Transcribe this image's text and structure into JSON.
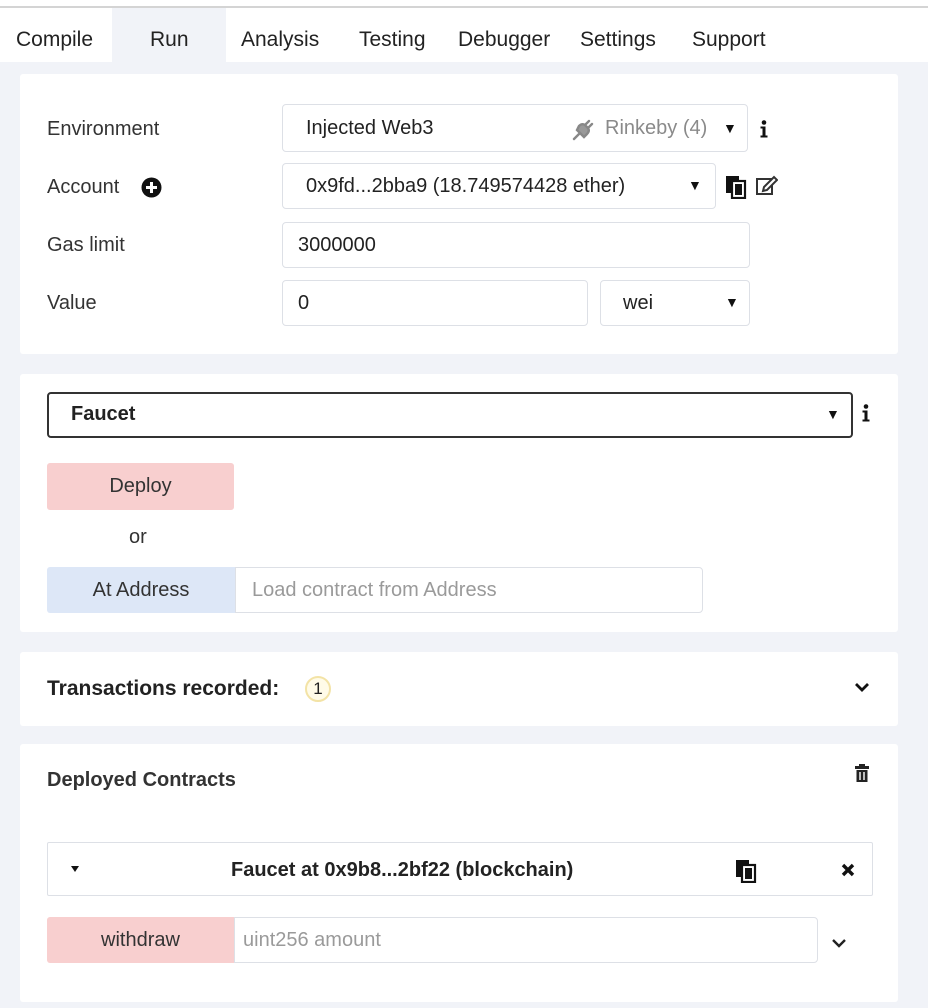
{
  "tabs": [
    "Compile",
    "Run",
    "Analysis",
    "Testing",
    "Debugger",
    "Settings",
    "Support"
  ],
  "active_tab": "Run",
  "env_section": {
    "environment_label": "Environment",
    "environment_value": "Injected Web3",
    "network": "Rinkeby (4)",
    "account_label": "Account",
    "account_value": "0x9fd...2bba9 (18.749574428 ether)",
    "gas_limit_label": "Gas limit",
    "gas_limit_value": "3000000",
    "value_label": "Value",
    "value_amount": "0",
    "value_unit": "wei"
  },
  "contract_section": {
    "selected_contract": "Faucet",
    "deploy_label": "Deploy",
    "or_text": "or",
    "at_address_label": "At Address",
    "at_address_placeholder": "Load contract from Address"
  },
  "transactions": {
    "label": "Transactions recorded:",
    "count": "1"
  },
  "deployed": {
    "title": "Deployed Contracts",
    "instance_label": "Faucet at 0x9b8...2bf22 (blockchain)",
    "function_name": "withdraw",
    "function_placeholder": "uint256 amount"
  },
  "colors": {
    "transact_button": "#f8cfcf",
    "at_address_button": "#dde7f7",
    "page_background": "#f1f3f8"
  }
}
